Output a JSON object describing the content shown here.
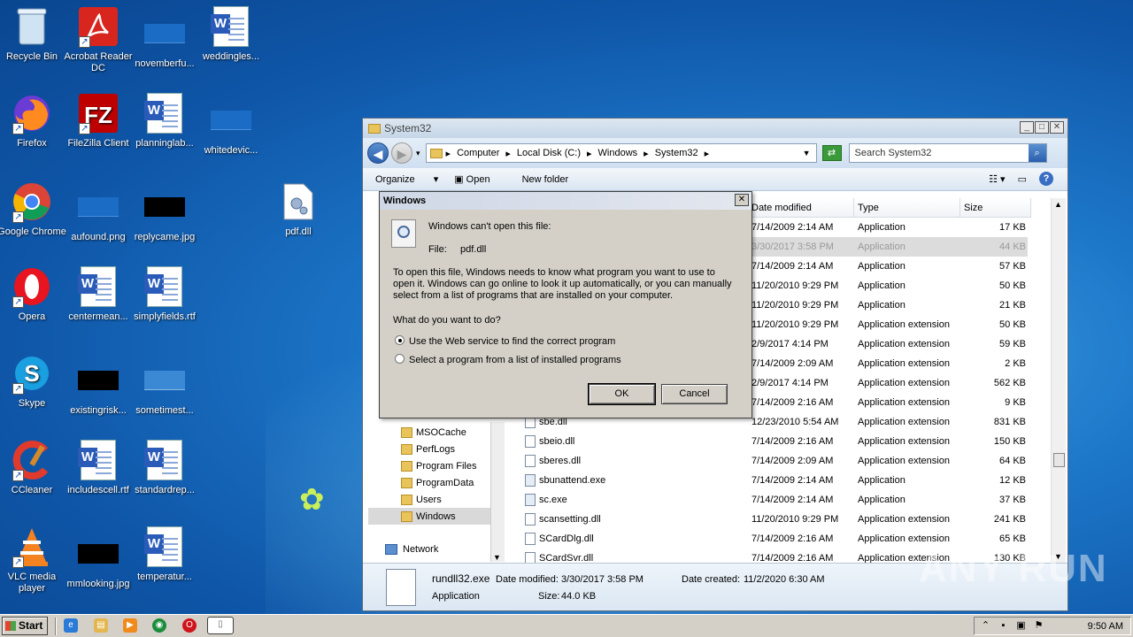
{
  "desktop": {
    "icons": [
      {
        "label": "Recycle Bin"
      },
      {
        "label": "Acrobat Reader DC"
      },
      {
        "label": "novemberfu..."
      },
      {
        "label": "weddingles..."
      },
      {
        "label": "Firefox"
      },
      {
        "label": "FileZilla Client"
      },
      {
        "label": "planninglab..."
      },
      {
        "label": "whitedevic..."
      },
      {
        "label": "Google Chrome"
      },
      {
        "label": "aufound.png"
      },
      {
        "label": "replycame.jpg"
      },
      {
        "label": "pdf.dll"
      },
      {
        "label": "Opera"
      },
      {
        "label": "centermean..."
      },
      {
        "label": "simplyfields.rtf"
      },
      {
        "label": "Skype"
      },
      {
        "label": "existingrisk..."
      },
      {
        "label": "sometimest..."
      },
      {
        "label": "CCleaner"
      },
      {
        "label": "includescell.rtf"
      },
      {
        "label": "standardrep..."
      },
      {
        "label": "VLC media player"
      },
      {
        "label": "mmlooking.jpg"
      },
      {
        "label": "temperatur..."
      }
    ]
  },
  "explorer": {
    "title": "System32",
    "breadcrumbs": [
      "Computer",
      "Local Disk (C:)",
      "Windows",
      "System32"
    ],
    "search_placeholder": "Search System32",
    "toolbar": {
      "organize": "Organize",
      "open": "Open",
      "new_folder": "New folder"
    },
    "columns": {
      "date": "Date modified",
      "type": "Type",
      "size": "Size"
    },
    "nav": {
      "items": [
        "MSOCache",
        "PerfLogs",
        "Program Files",
        "ProgramData",
        "Users",
        "Windows"
      ],
      "selected": "Windows",
      "network": "Network"
    },
    "files": [
      {
        "name": "",
        "date": "7/14/2009 2:14 AM",
        "type": "Application",
        "size": "17 KB"
      },
      {
        "name": "",
        "date": "3/30/2017 3:58 PM",
        "type": "Application",
        "size": "44 KB"
      },
      {
        "name": "",
        "date": "7/14/2009 2:14 AM",
        "type": "Application",
        "size": "57 KB"
      },
      {
        "name": "",
        "date": "11/20/2010 9:29 PM",
        "type": "Application",
        "size": "50 KB"
      },
      {
        "name": "",
        "date": "11/20/2010 9:29 PM",
        "type": "Application",
        "size": "21 KB"
      },
      {
        "name": "",
        "date": "11/20/2010 9:29 PM",
        "type": "Application extension",
        "size": "50 KB"
      },
      {
        "name": "",
        "date": "2/9/2017 4:14 PM",
        "type": "Application extension",
        "size": "59 KB"
      },
      {
        "name": "",
        "date": "7/14/2009 2:09 AM",
        "type": "Application extension",
        "size": "2 KB"
      },
      {
        "name": "",
        "date": "2/9/2017 4:14 PM",
        "type": "Application extension",
        "size": "562 KB"
      },
      {
        "name": "",
        "date": "7/14/2009 2:16 AM",
        "type": "Application extension",
        "size": "9 KB"
      },
      {
        "name": "sbe.dll",
        "date": "12/23/2010 5:54 AM",
        "type": "Application extension",
        "size": "831 KB"
      },
      {
        "name": "sbeio.dll",
        "date": "7/14/2009 2:16 AM",
        "type": "Application extension",
        "size": "150 KB"
      },
      {
        "name": "sberes.dll",
        "date": "7/14/2009 2:09 AM",
        "type": "Application extension",
        "size": "64 KB"
      },
      {
        "name": "sbunattend.exe",
        "date": "7/14/2009 2:14 AM",
        "type": "Application",
        "size": "12 KB"
      },
      {
        "name": "sc.exe",
        "date": "7/14/2009 2:14 AM",
        "type": "Application",
        "size": "37 KB"
      },
      {
        "name": "scansetting.dll",
        "date": "11/20/2010 9:29 PM",
        "type": "Application extension",
        "size": "241 KB"
      },
      {
        "name": "SCardDlg.dll",
        "date": "7/14/2009 2:16 AM",
        "type": "Application extension",
        "size": "65 KB"
      },
      {
        "name": "SCardSvr.dll",
        "date": "7/14/2009 2:16 AM",
        "type": "Application extension",
        "size": "130 KB"
      }
    ],
    "details": {
      "name": "rundll32.exe",
      "date_modified_label": "Date modified:",
      "date_modified": "3/30/2017 3:58 PM",
      "date_created_label": "Date created:",
      "date_created": "11/2/2020 6:30 AM",
      "type": "Application",
      "size_label": "Size:",
      "size": "44.0 KB"
    }
  },
  "dialog": {
    "title": "Windows",
    "heading": "Windows can't open this file:",
    "file_label": "File:",
    "file_name": "pdf.dll",
    "body1": "To open this file, Windows needs to know what program you want to use to",
    "body2": "open it. Windows can go online to look it up automatically, or you can manually",
    "body3": "select from a list of programs that are installed on your computer.",
    "question": "What do you want to do?",
    "option1": "Use the Web service to find the correct program",
    "option2": "Select a program from a list of installed programs",
    "ok": "OK",
    "cancel": "Cancel"
  },
  "taskbar": {
    "start": "Start",
    "clock": "9:50 AM"
  },
  "watermark": "ANY RUN"
}
